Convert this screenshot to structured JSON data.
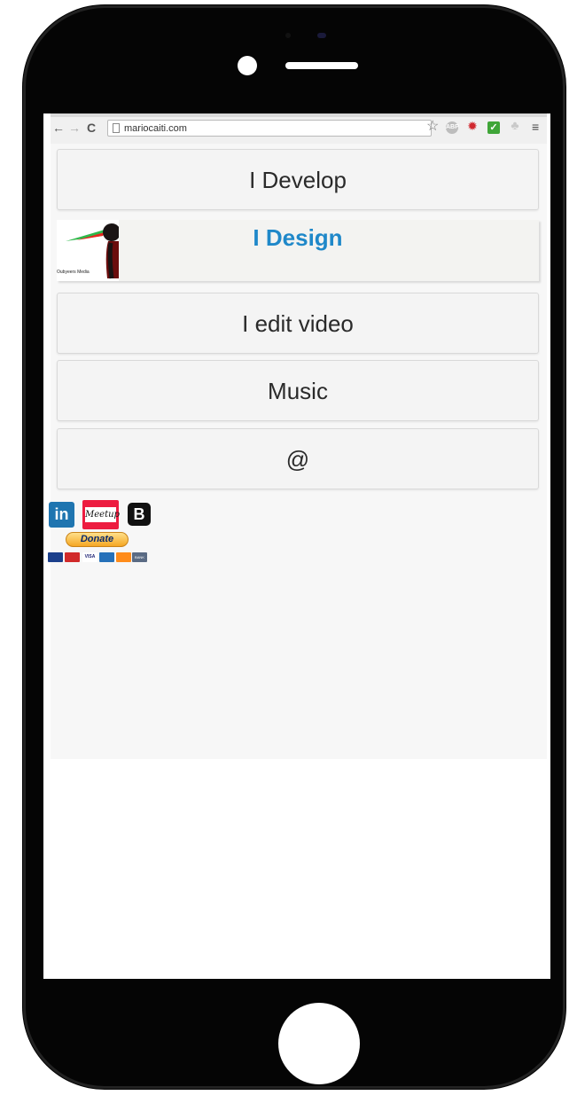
{
  "browser": {
    "url": "mariocaiti.com",
    "nav": {
      "back": "←",
      "forward": "→",
      "reload": "C"
    },
    "star": "☆",
    "extensions": {
      "abp": "ABP",
      "gear": "✹",
      "check": "✓",
      "puzzle": "♣"
    },
    "menu": "≡"
  },
  "menu": {
    "develop": "I Develop",
    "design": "I Design",
    "video": "I edit video",
    "music": "Music",
    "email": "@"
  },
  "logo": {
    "caption": "Oubyeers Media"
  },
  "social": {
    "linkedin": "in",
    "meetup": "Meetup",
    "blogger": "B"
  },
  "donate": {
    "label": "Donate"
  },
  "payment_cards": [
    "",
    "",
    "VISA",
    "",
    "",
    "BANK"
  ],
  "colors": {
    "design_accent": "#1f88c9",
    "page_bg": "#f7f7f7",
    "phone": "#050505"
  }
}
